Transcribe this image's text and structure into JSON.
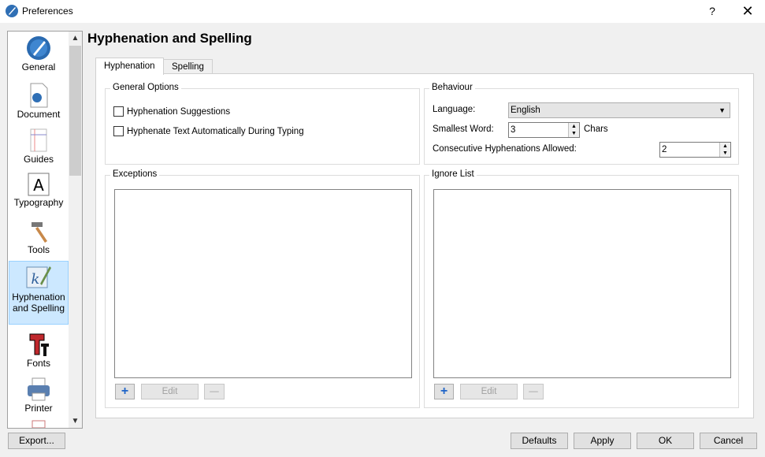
{
  "window": {
    "title": "Preferences",
    "help_glyph": "?",
    "close_glyph": "✕"
  },
  "sidebar": {
    "items": [
      {
        "label": "General",
        "icon": "general-icon"
      },
      {
        "label": "Document",
        "icon": "document-icon"
      },
      {
        "label": "Guides",
        "icon": "guides-icon"
      },
      {
        "label": "Typography",
        "icon": "typography-icon"
      },
      {
        "label": "Tools",
        "icon": "tools-icon"
      },
      {
        "label": "Hyphenation and Spelling",
        "label_line1": "Hyphenation",
        "label_line2": "and Spelling",
        "icon": "hyphenation-icon",
        "selected": true
      },
      {
        "label": "Fonts",
        "icon": "fonts-icon"
      },
      {
        "label": "Printer",
        "icon": "printer-icon"
      }
    ],
    "scroll_up": "▲",
    "scroll_down": "▼"
  },
  "header": {
    "title": "Hyphenation and Spelling"
  },
  "tabs": [
    {
      "label": "Hyphenation",
      "active": true
    },
    {
      "label": "Spelling",
      "active": false
    }
  ],
  "general_options": {
    "title": "General Options",
    "hyphenation_suggestions": "Hyphenation Suggestions",
    "hyphenate_auto": "Hyphenate Text Automatically During Typing"
  },
  "behaviour": {
    "title": "Behaviour",
    "language_label": "Language:",
    "language_value": "English",
    "smallest_word_label": "Smallest Word:",
    "smallest_word_value": "3",
    "chars_label": "Chars",
    "consecutive_label": "Consecutive Hyphenations Allowed:",
    "consecutive_value": "2"
  },
  "exceptions": {
    "title": "Exceptions",
    "add": "+",
    "edit": "Edit",
    "remove": "—"
  },
  "ignore_list": {
    "title": "Ignore List",
    "add": "+",
    "edit": "Edit",
    "remove": "—"
  },
  "footer": {
    "export": "Export...",
    "defaults": "Defaults",
    "apply": "Apply",
    "ok": "OK",
    "cancel": "Cancel"
  },
  "colors": {
    "selected_bg": "#cce8ff",
    "selected_border": "#99d1ff",
    "plus_blue": "#1e64c8"
  }
}
